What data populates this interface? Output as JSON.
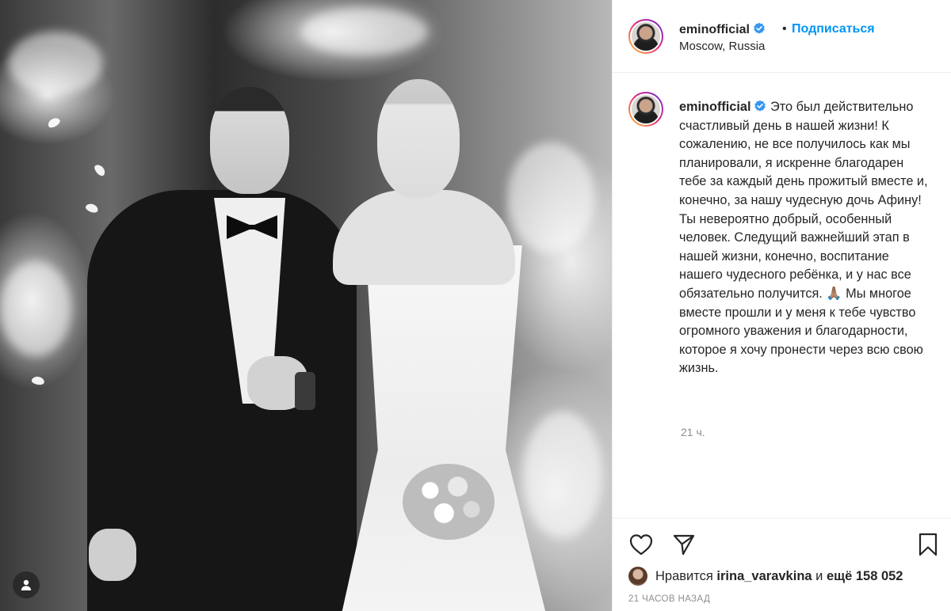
{
  "post": {
    "photo_alt_user_icon": "user-tag-icon"
  },
  "header": {
    "username": "eminofficial",
    "separator": "•",
    "follow_label": "Подписаться",
    "location": "Moscow, Russia"
  },
  "caption": {
    "username": "eminofficial",
    "text": "Это был действительно счастливый день в нашей жизни! К сожалению, не все получилось как мы планировали, я искренне благодарен тебе за каждый день прожитый вместе и, конечно, за нашу чудесную дочь Афину! Ты невероятно добрый, особенный человек. Следущий важнейший этап в нашей жизни, конечно, воспитание нашего чудесного ребёнка, и у нас все обязательно получится. 🙏🏽 Мы многое вместе прошли и у меня к тебе чувство огромного уважения и благодарности, которое я хочу пронести через всю свою жизнь.",
    "time": "21 ч."
  },
  "actions": {
    "likes_prefix": "Нравится",
    "likes_user": "irina_varavkina",
    "likes_middle": "и",
    "likes_count": "ещё 158 052",
    "timestamp": "21 ЧАСОВ НАЗАД"
  },
  "colors": {
    "accent": "#0095f6",
    "verified": "#3897f0",
    "muted": "#8e8e8e",
    "text": "#262626"
  },
  "icons": [
    "verified-badge-icon",
    "heart-icon",
    "paper-plane-icon",
    "bookmark-icon",
    "user-tag-icon"
  ]
}
